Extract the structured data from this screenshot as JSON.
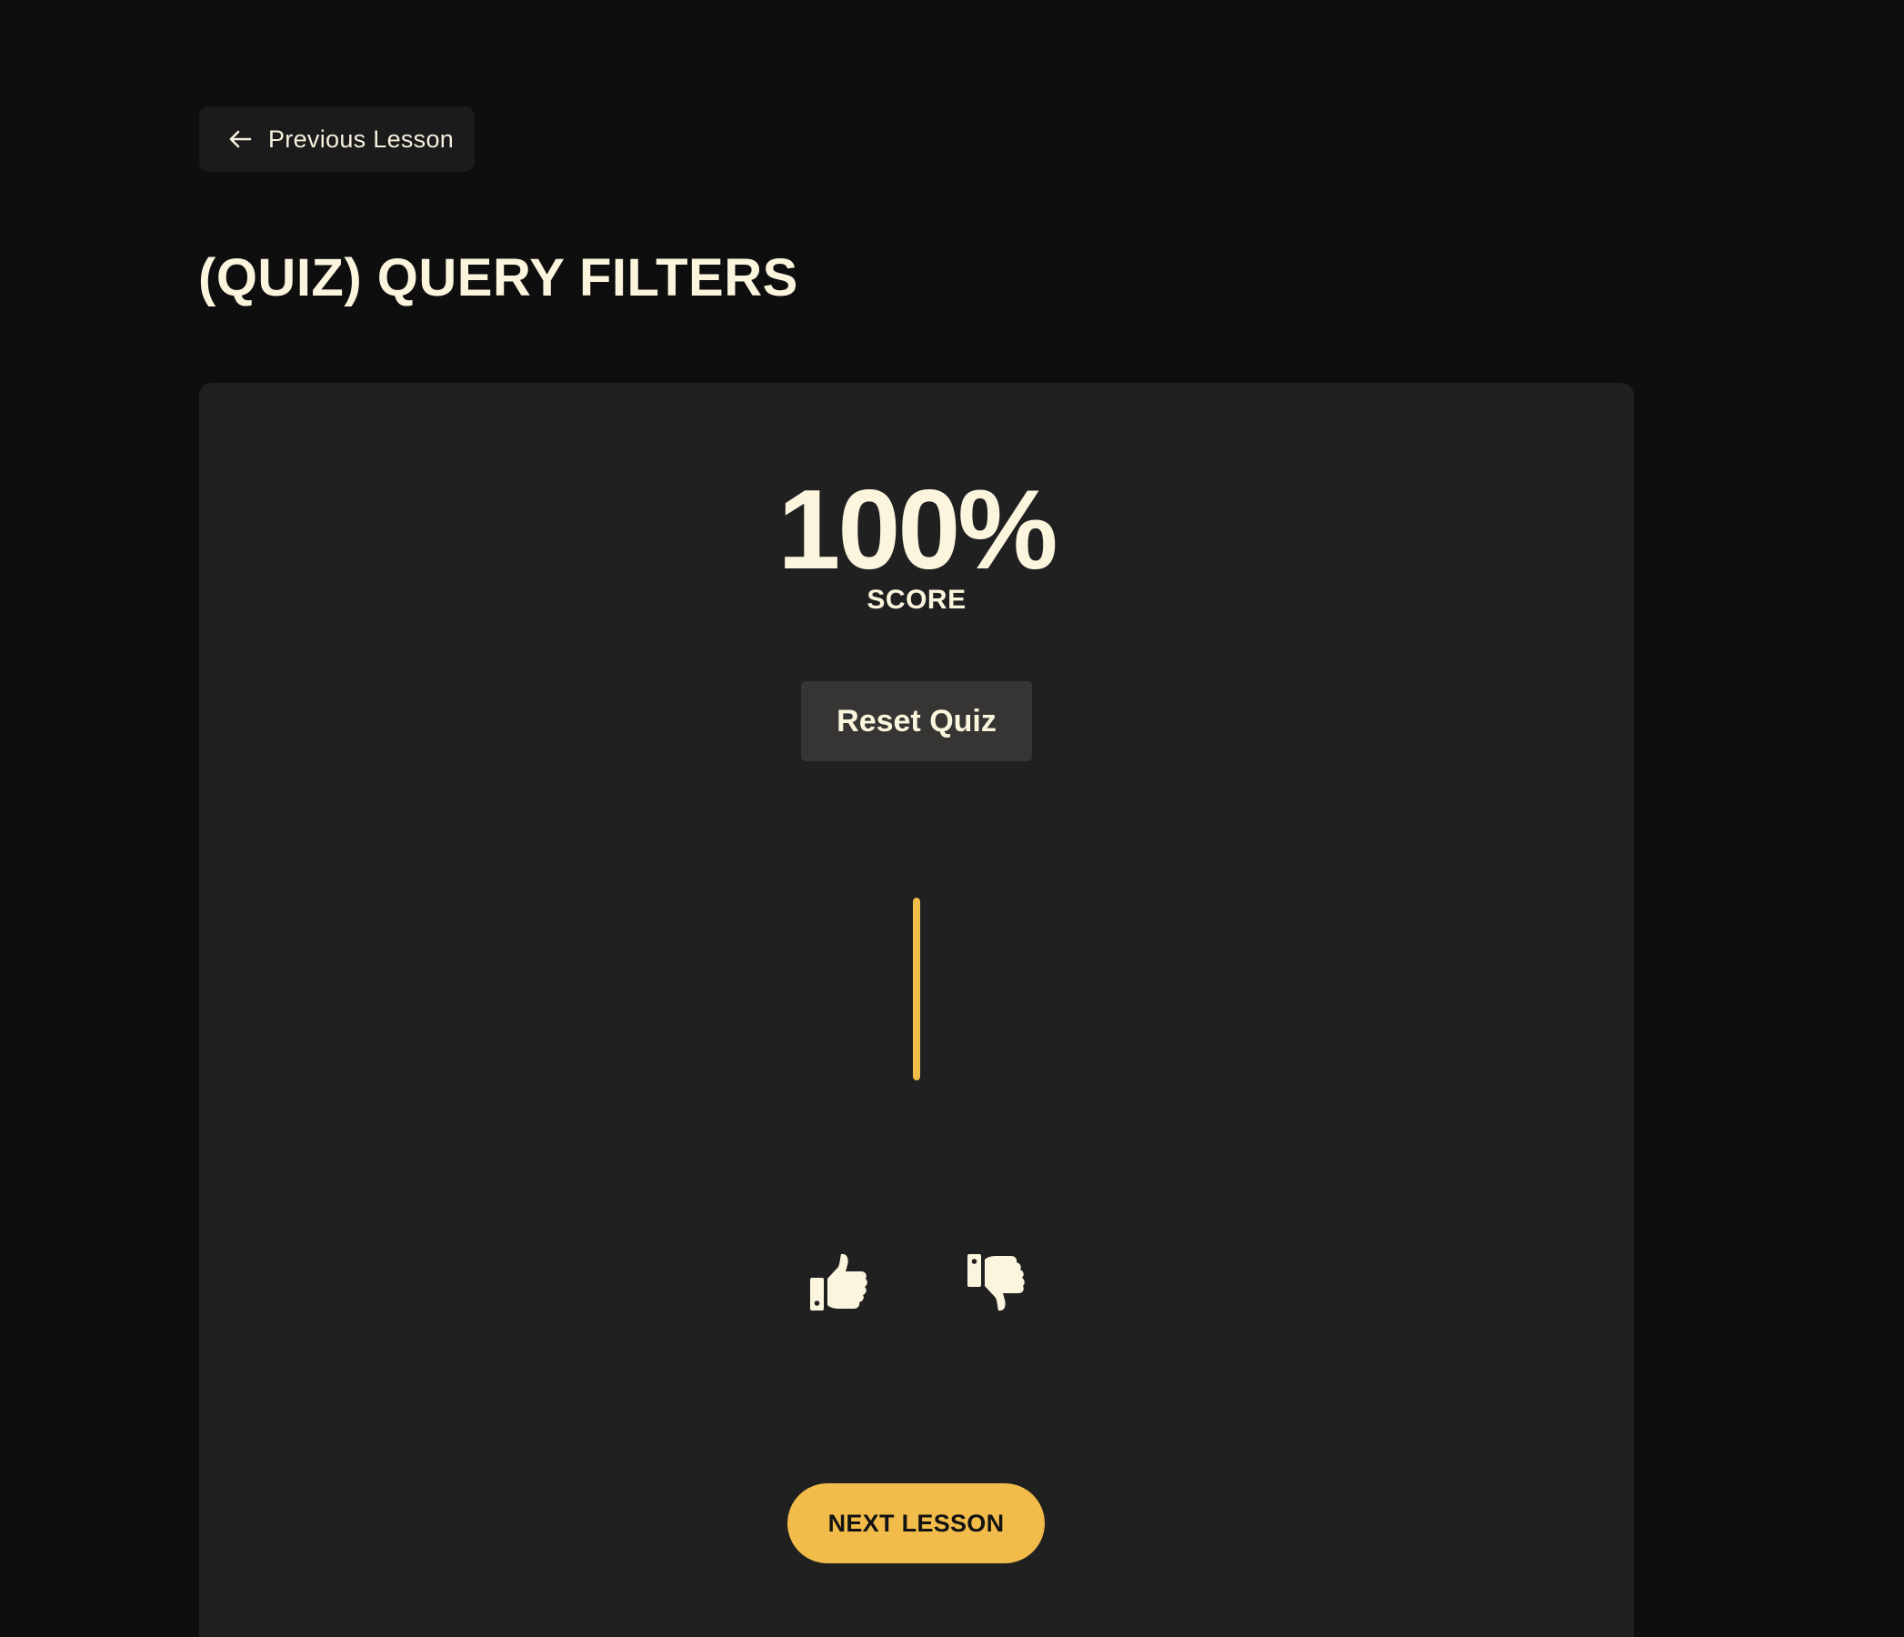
{
  "nav": {
    "previous_label": "Previous Lesson",
    "previous_icon": "arrow-left-icon"
  },
  "lesson": {
    "title": "(QUIZ) QUERY FILTERS"
  },
  "quiz": {
    "score": "100%",
    "score_label": "SCORE",
    "reset_label": "Reset Quiz",
    "progress_fraction": 1.0
  },
  "feedback": {
    "up_icon": "thumbs-up-icon",
    "down_icon": "thumbs-down-icon"
  },
  "actions": {
    "next_label": "NEXT LESSON"
  },
  "colors": {
    "background": "#0f0e0f",
    "card": "#212021",
    "text": "#fbf5de",
    "accent": "#f2bc4a",
    "button_dark": "#373534"
  }
}
